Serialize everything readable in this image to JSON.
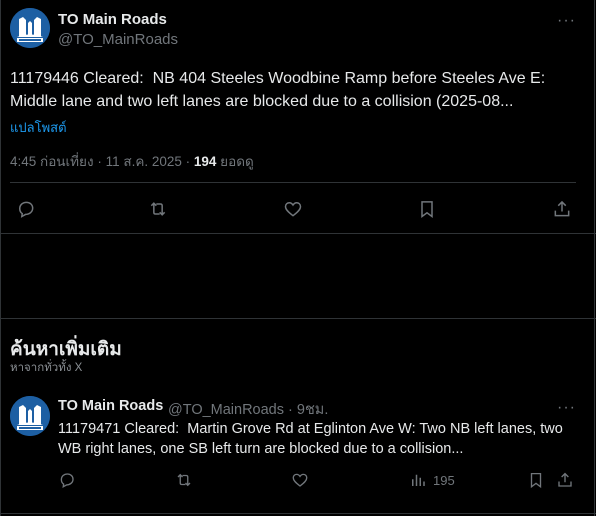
{
  "tweet": {
    "author_name": "TO Main Roads",
    "author_handle": "@TO_MainRoads",
    "more": "···",
    "text_line1": "11179446 Cleared:  NB 404 Steeles Woodbine Ramp before Steeles Ave E:",
    "text_line2": "Middle lane and two left lanes are blocked due to a collision (2025-08...",
    "translate": "แปลโพสต์",
    "time": "4:45 ก่อนเที่ยง",
    "sep1": " · ",
    "date": "11 ส.ค. 2025",
    "sep2": " · ",
    "views_count": "194",
    "views_label": " ยอดดู"
  },
  "section": {
    "title": "ค้นหาเพิ่มเติม",
    "subtitle": "หาจากทั่วทั้ง X"
  },
  "related": {
    "author_name": "TO Main Roads",
    "author_handle": "@TO_MainRoads",
    "sep": " · ",
    "age": "9ชม.",
    "more": "···",
    "text_line1": "11179471 Cleared:  Martin Grove Rd at Eglinton Ave W: Two NB left lanes, two",
    "text_line2": "WB right lanes, one SB left turn are blocked due to a collision...",
    "views": "195"
  },
  "icons": {
    "reply": "reply-icon",
    "repost": "repost-icon",
    "like": "heart-icon",
    "bookmark": "bookmark-icon",
    "share": "share-icon",
    "views": "views-chart-icon"
  },
  "colors": {
    "background": "#000000",
    "text": "#e7e9ea",
    "muted": "#71767b",
    "link": "#1d9bf0",
    "border": "#2f3336"
  }
}
